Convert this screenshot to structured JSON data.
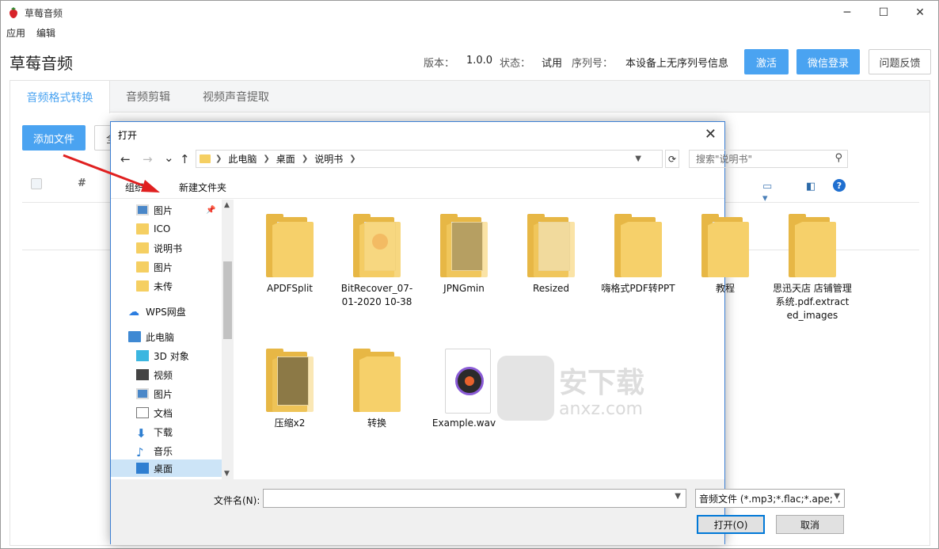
{
  "window": {
    "title": "草莓音频",
    "controls": {
      "minimize": "─",
      "maximize": "☐",
      "close": "✕"
    }
  },
  "menu": [
    "应用",
    "编辑"
  ],
  "app": {
    "heading": "草莓音频",
    "version_label": "版本：",
    "version_value": "1.0.0",
    "status_label": "状态：",
    "status_value": "试用",
    "serial_label": "序列号：",
    "serial_value": "本设备上无序列号信息",
    "activate_label": "激活",
    "wechat_label": "微信登录",
    "feedback_label": "问题反馈"
  },
  "tabs": [
    {
      "label": "音频格式转换",
      "active": true
    },
    {
      "label": "音频剪辑",
      "active": false
    },
    {
      "label": "视频声音提取",
      "active": false
    }
  ],
  "content": {
    "add_file_label": "添加文件",
    "select_all_label": "全",
    "col_index": "#"
  },
  "dialog": {
    "title": "打开",
    "close": "✕",
    "nav": {
      "back": "←",
      "forward": "→",
      "recent": "⌄",
      "up": "↑"
    },
    "path": [
      "此电脑",
      "桌面",
      "说明书"
    ],
    "search_placeholder": "搜索\"说明书\"",
    "toolbar": {
      "organize": "组织",
      "new_folder": "新建文件夹"
    },
    "sidebar": [
      {
        "label": "图片",
        "icon": "picture-icon",
        "pinned": true
      },
      {
        "label": "ICO",
        "icon": "folder-icon"
      },
      {
        "label": "说明书",
        "icon": "folder-icon"
      },
      {
        "label": "图片",
        "icon": "folder-icon"
      },
      {
        "label": "未传",
        "icon": "folder-icon"
      },
      {
        "label": "WPS网盘",
        "icon": "cloud-icon"
      },
      {
        "label": "此电脑",
        "icon": "computer-icon"
      },
      {
        "label": "3D 对象",
        "icon": "cube-icon"
      },
      {
        "label": "视频",
        "icon": "film-icon"
      },
      {
        "label": "图片",
        "icon": "picture-icon"
      },
      {
        "label": "文档",
        "icon": "document-icon"
      },
      {
        "label": "下载",
        "icon": "download-icon"
      },
      {
        "label": "音乐",
        "icon": "music-icon"
      },
      {
        "label": "桌面",
        "icon": "desktop-icon",
        "selected": true
      }
    ],
    "files": [
      {
        "name": "APDFSplit",
        "type": "folder"
      },
      {
        "name": "BitRecover_07-01-2020 10-38",
        "type": "folder"
      },
      {
        "name": "JPNGmin",
        "type": "folder"
      },
      {
        "name": "Resized",
        "type": "folder"
      },
      {
        "name": "嗨格式PDF转PPT",
        "type": "folder"
      },
      {
        "name": "教程",
        "type": "folder"
      },
      {
        "name": "思迅天店 店铺管理系统.pdf.extracted_images",
        "type": "folder"
      },
      {
        "name": "压缩x2",
        "type": "folder"
      },
      {
        "name": "转换",
        "type": "folder"
      },
      {
        "name": "Example.wav",
        "type": "audio"
      }
    ],
    "watermark": {
      "text": "安下载",
      "url": "anxz.com"
    },
    "filename_label": "文件名(N):",
    "filename_value": "",
    "filter_value": "音频文件 (*.mp3;*.flac;*.ape;*.",
    "open_label": "打开(O)",
    "cancel_label": "取消"
  },
  "colors": {
    "accent": "#4aa3f1",
    "arrow": "#e02020",
    "dialog_border": "#3c7fd3",
    "selection": "#cce4f7"
  }
}
